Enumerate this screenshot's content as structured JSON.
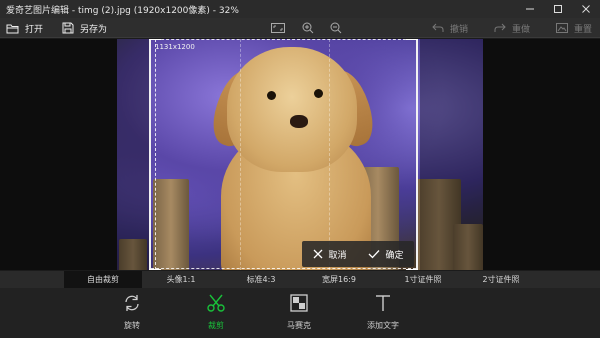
{
  "window": {
    "title": "爱奇艺图片编辑 - timg (2).jpg (1920x1200像素) - 32%",
    "controls": [
      "minimize",
      "maximize",
      "close"
    ]
  },
  "toolbar": {
    "open_label": "打开",
    "save_as_label": "另存为",
    "undo_label": "撤销",
    "redo_label": "重做",
    "reset_label": "重置"
  },
  "crop": {
    "size_label": "1131x1200",
    "cancel_label": "取消",
    "confirm_label": "确定"
  },
  "presets": {
    "items": [
      {
        "label": "自由裁剪",
        "active": true
      },
      {
        "label": "头像1:1",
        "active": false
      },
      {
        "label": "标准4:3",
        "active": false
      },
      {
        "label": "宽屏16:9",
        "active": false
      },
      {
        "label": "1寸证件照",
        "active": false
      },
      {
        "label": "2寸证件照",
        "active": false
      }
    ]
  },
  "tools": {
    "items": [
      {
        "label": "旋转",
        "icon": "rotate-icon",
        "active": false
      },
      {
        "label": "裁剪",
        "icon": "crop-scissors-icon",
        "active": true
      },
      {
        "label": "马赛克",
        "icon": "mosaic-icon",
        "active": false
      },
      {
        "label": "添加文字",
        "icon": "text-icon",
        "active": false
      }
    ]
  },
  "colors": {
    "accent": "#19c13a",
    "background": "#1b1b1b"
  }
}
